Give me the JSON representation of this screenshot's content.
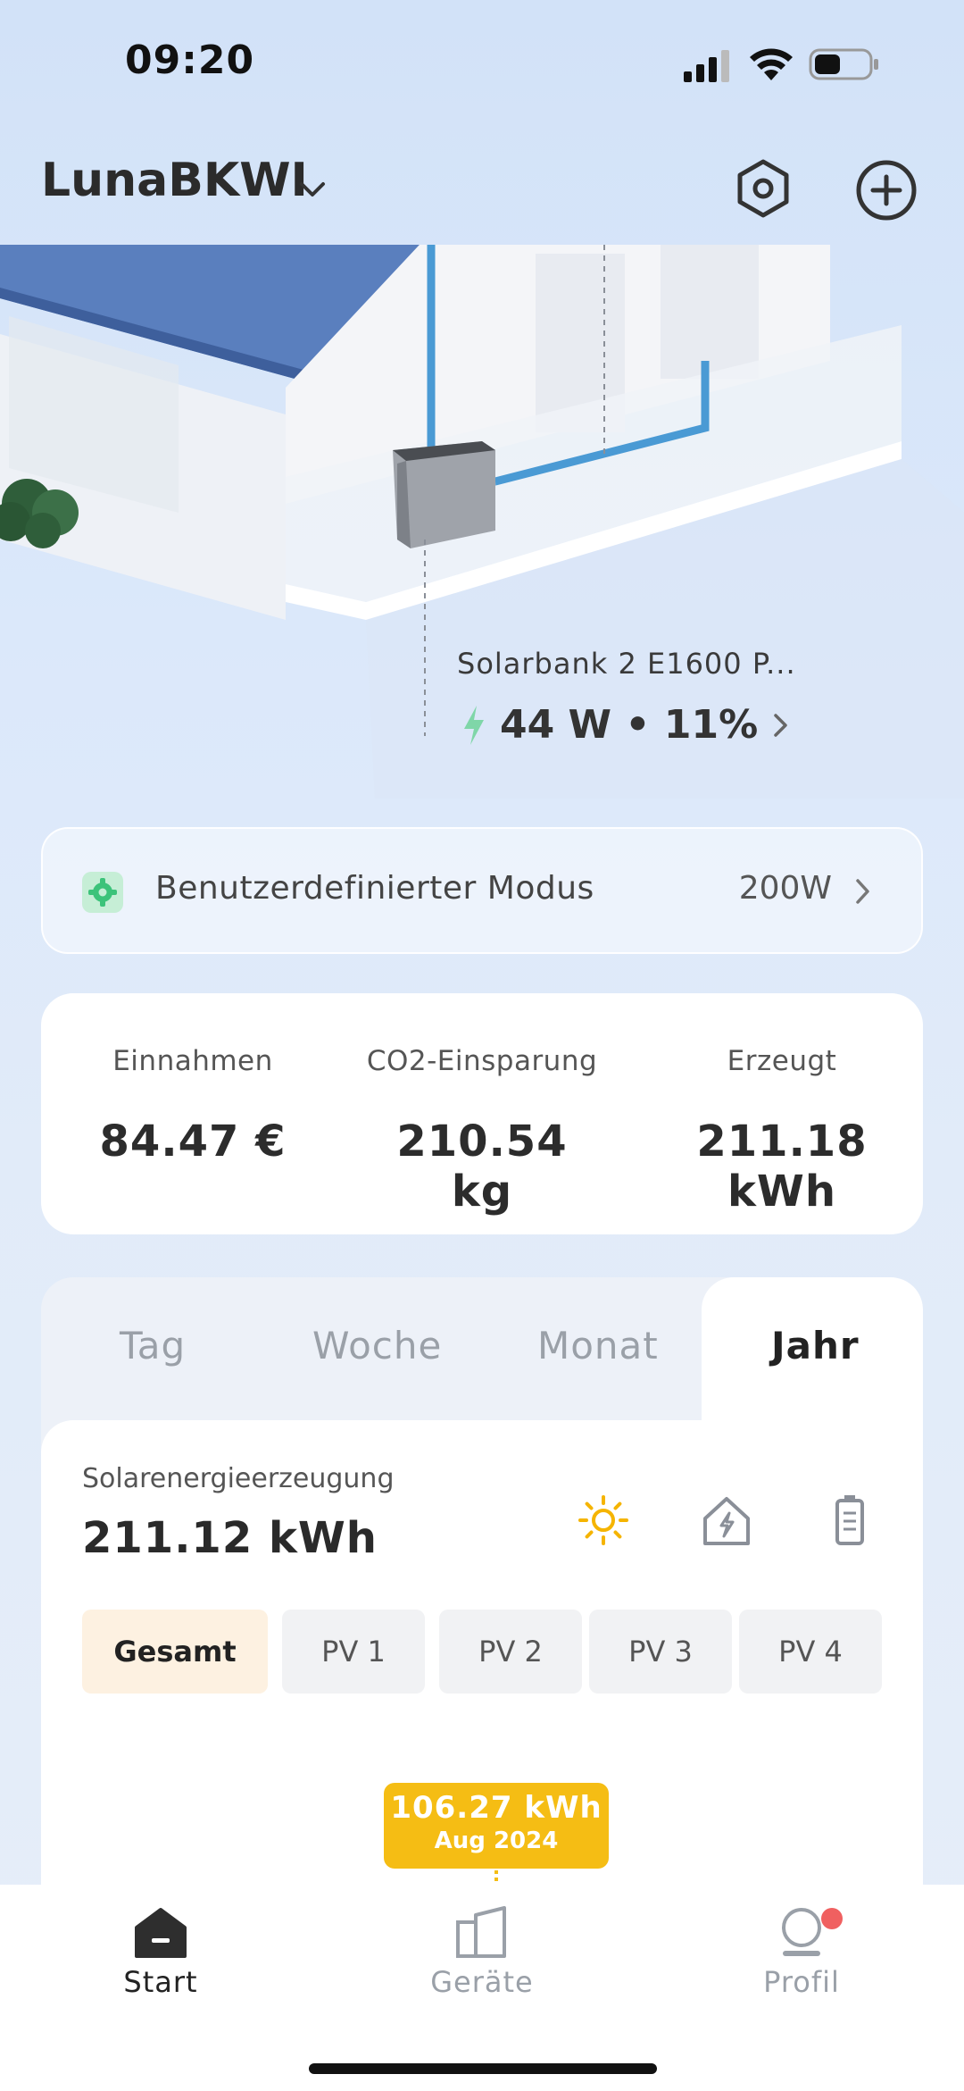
{
  "status_bar": {
    "time": "09:20"
  },
  "header": {
    "title": "LunaBKWI"
  },
  "device": {
    "name": "Solarbank 2 E1600 P...",
    "stats": "44 W • 11%"
  },
  "mode": {
    "label": "Benutzerdefinierter Modus",
    "value": "200W"
  },
  "stats": [
    {
      "label": "Einnahmen",
      "value": "84.47 €"
    },
    {
      "label": "CO2-Einsparung",
      "value": "210.54 kg"
    },
    {
      "label": "Erzeugt",
      "value": "211.18 kWh"
    }
  ],
  "tabs": [
    "Tag",
    "Woche",
    "Monat",
    "Jahr"
  ],
  "active_tab": "Jahr",
  "panel": {
    "subtitle": "Solarenergieerzeugung",
    "value": "211.12 kWh",
    "icons": [
      "sun-icon",
      "house-lightning-icon",
      "battery-icon"
    ],
    "sources": [
      "Gesamt",
      "PV 1",
      "PV 2",
      "PV 3",
      "PV 4"
    ],
    "active_source": "Gesamt"
  },
  "tooltip": {
    "value": "106.27 kWh",
    "period": "Aug 2024"
  },
  "nav": [
    {
      "label": "Start",
      "icon": "home-icon"
    },
    {
      "label": "Geräte",
      "icon": "devices-icon"
    },
    {
      "label": "Profil",
      "icon": "profile-icon"
    }
  ],
  "colors": {
    "accent": "#f5bd14",
    "mode_icon": "#3cc37a",
    "pipe": "#4a9ad4",
    "badge": "#f06060"
  }
}
